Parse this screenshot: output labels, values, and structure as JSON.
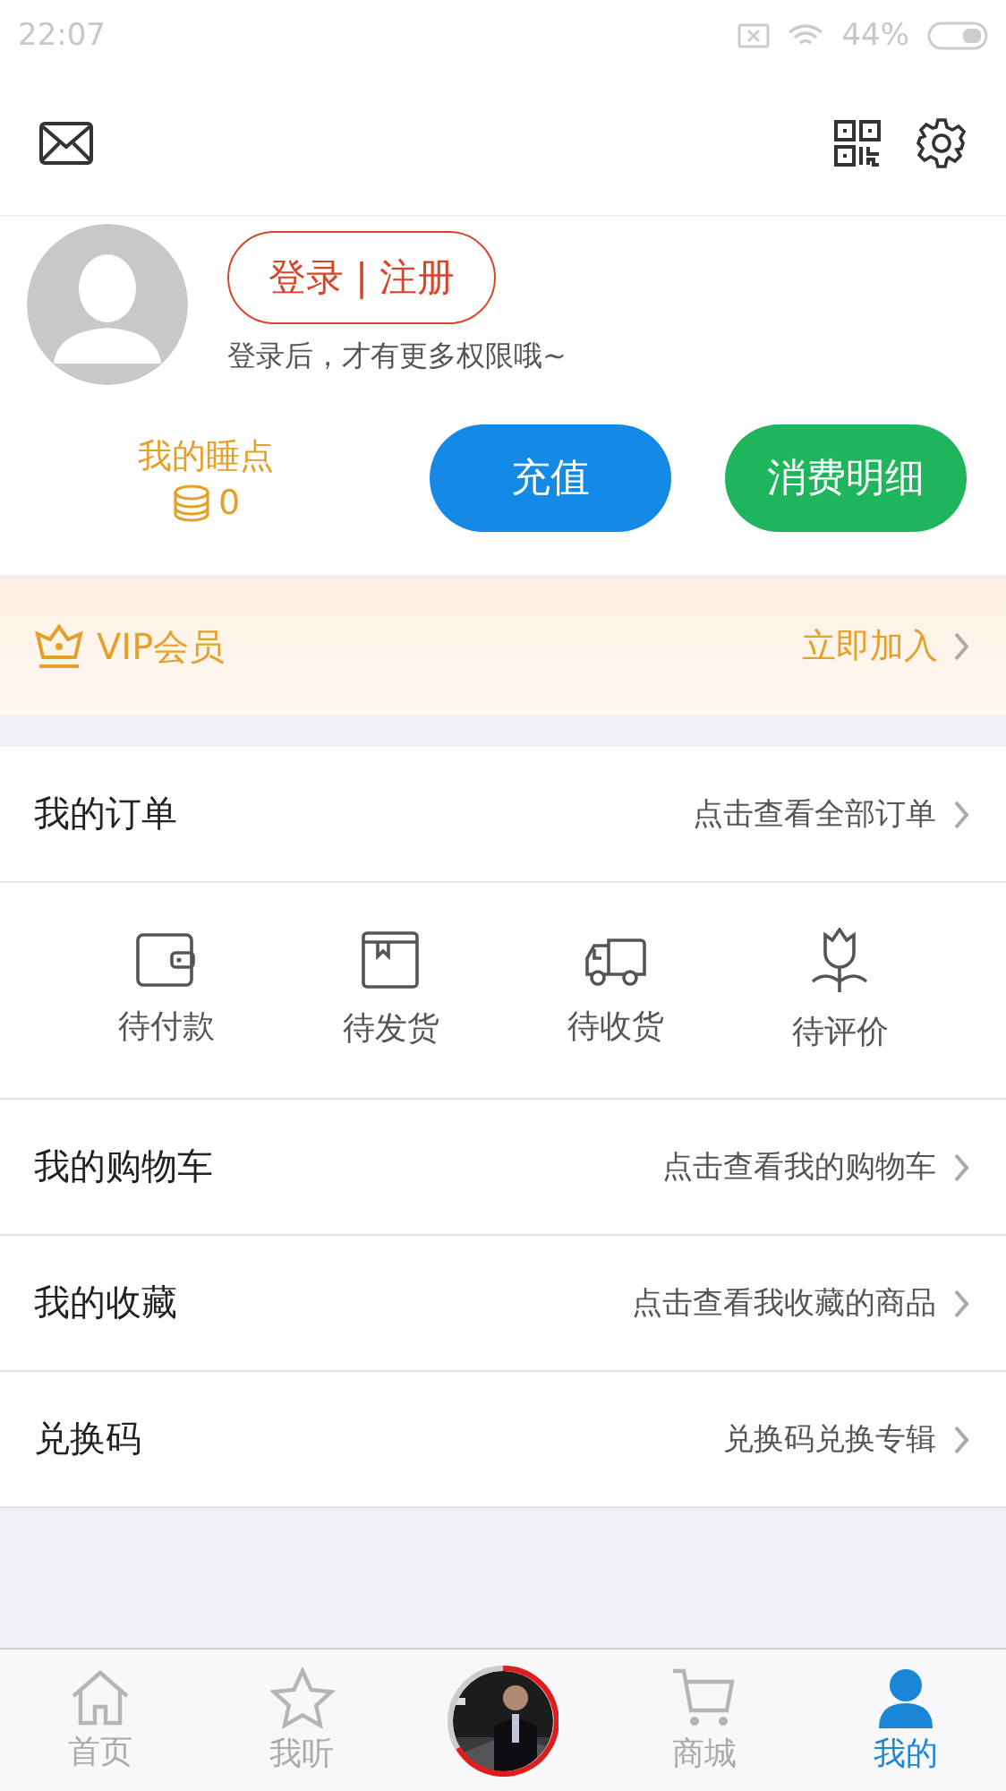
{
  "status_bar": {
    "time": "22:07",
    "battery": "44%"
  },
  "profile": {
    "login_button": "登录 | 注册",
    "hint": "登录后，才有更多权限哦~",
    "points_label": "我的睡点",
    "points_value": "0",
    "recharge_button": "充值",
    "details_button": "消费明细"
  },
  "vip": {
    "label": "VIP会员",
    "action": "立即加入"
  },
  "orders": {
    "title": "我的订单",
    "link": "点击查看全部订单",
    "statuses": [
      {
        "kind": "wallet",
        "label": "待付款"
      },
      {
        "kind": "box",
        "label": "待发货"
      },
      {
        "kind": "truck",
        "label": "待收货"
      },
      {
        "kind": "flower",
        "label": "待评价"
      }
    ]
  },
  "menu": [
    {
      "title": "我的购物车",
      "link": "点击查看我的购物车"
    },
    {
      "title": "我的收藏",
      "link": "点击查看我收藏的商品"
    },
    {
      "title": "兑换码",
      "link": "兑换码兑换专辑"
    }
  ],
  "tabs": [
    {
      "kind": "home",
      "label": "首页",
      "selected": false
    },
    {
      "kind": "star",
      "label": "我听",
      "selected": false
    },
    {
      "kind": "player"
    },
    {
      "kind": "cart",
      "label": "商城",
      "selected": false
    },
    {
      "kind": "person",
      "label": "我的",
      "selected": true
    }
  ]
}
